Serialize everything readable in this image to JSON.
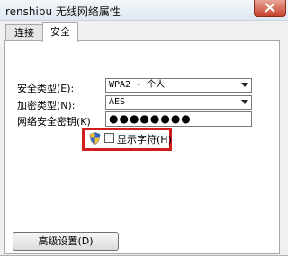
{
  "window": {
    "title": "renshibu 无线网络属性"
  },
  "tabs": [
    {
      "label": "连接"
    },
    {
      "label": "安全"
    }
  ],
  "security_type": {
    "label": "安全类型(E):",
    "value": "WPA2 - 个人"
  },
  "encryption_type": {
    "label": "加密类型(N):",
    "value": "AES"
  },
  "network_key": {
    "label": "网络安全密钥(K)",
    "value": "●●●●●●●●"
  },
  "show_chars": {
    "label": "显示字符(H)",
    "checked": false
  },
  "advanced": {
    "label": "高级设置(D)"
  },
  "colors": {
    "highlight": "#d11d1d",
    "titlebar": "#dfe8f1",
    "close": "#c7442e"
  }
}
